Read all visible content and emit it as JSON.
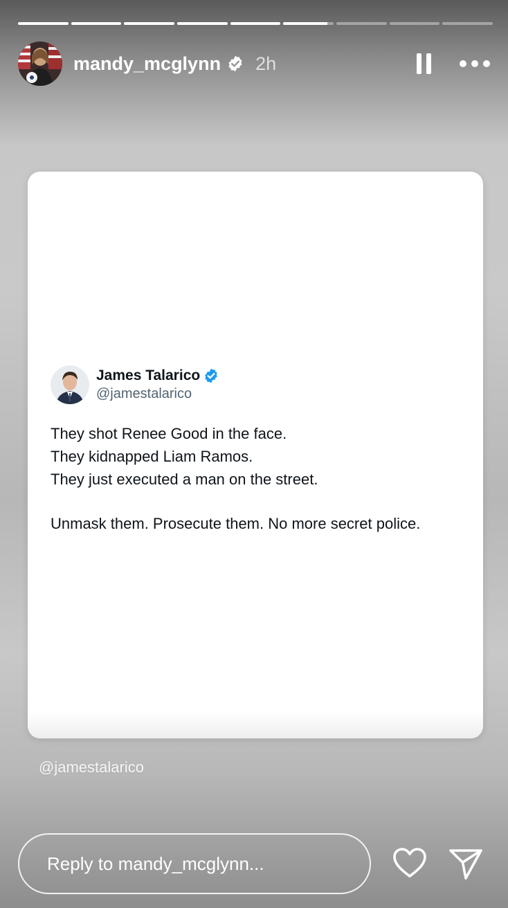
{
  "story": {
    "progress_segments": [
      1,
      1,
      1,
      1,
      1,
      0.88,
      0,
      0,
      0
    ],
    "user": {
      "username": "mandy_mcglynn",
      "time": "2h",
      "verified_icon": "verified-badge-icon"
    },
    "controls": {
      "pause_icon": "pause-icon",
      "more_icon": "more-options-icon"
    }
  },
  "tweet": {
    "name": "James Talarico",
    "handle": "@jamestalarico",
    "lines": [
      "They shot Renee Good in the face.",
      "They kidnapped Liam Ramos.",
      "They just executed a man on the street."
    ],
    "closing": "Unmask them. Prosecute them. No more secret police."
  },
  "mention_tag": "@jamestalarico",
  "reply": {
    "placeholder": "Reply to mandy_mcglynn...",
    "like_icon": "heart-icon",
    "share_icon": "send-icon"
  },
  "colors": {
    "verified_blue": "#1d9bf0",
    "tweet_text": "#0f1419",
    "handle_gray": "#536471"
  }
}
